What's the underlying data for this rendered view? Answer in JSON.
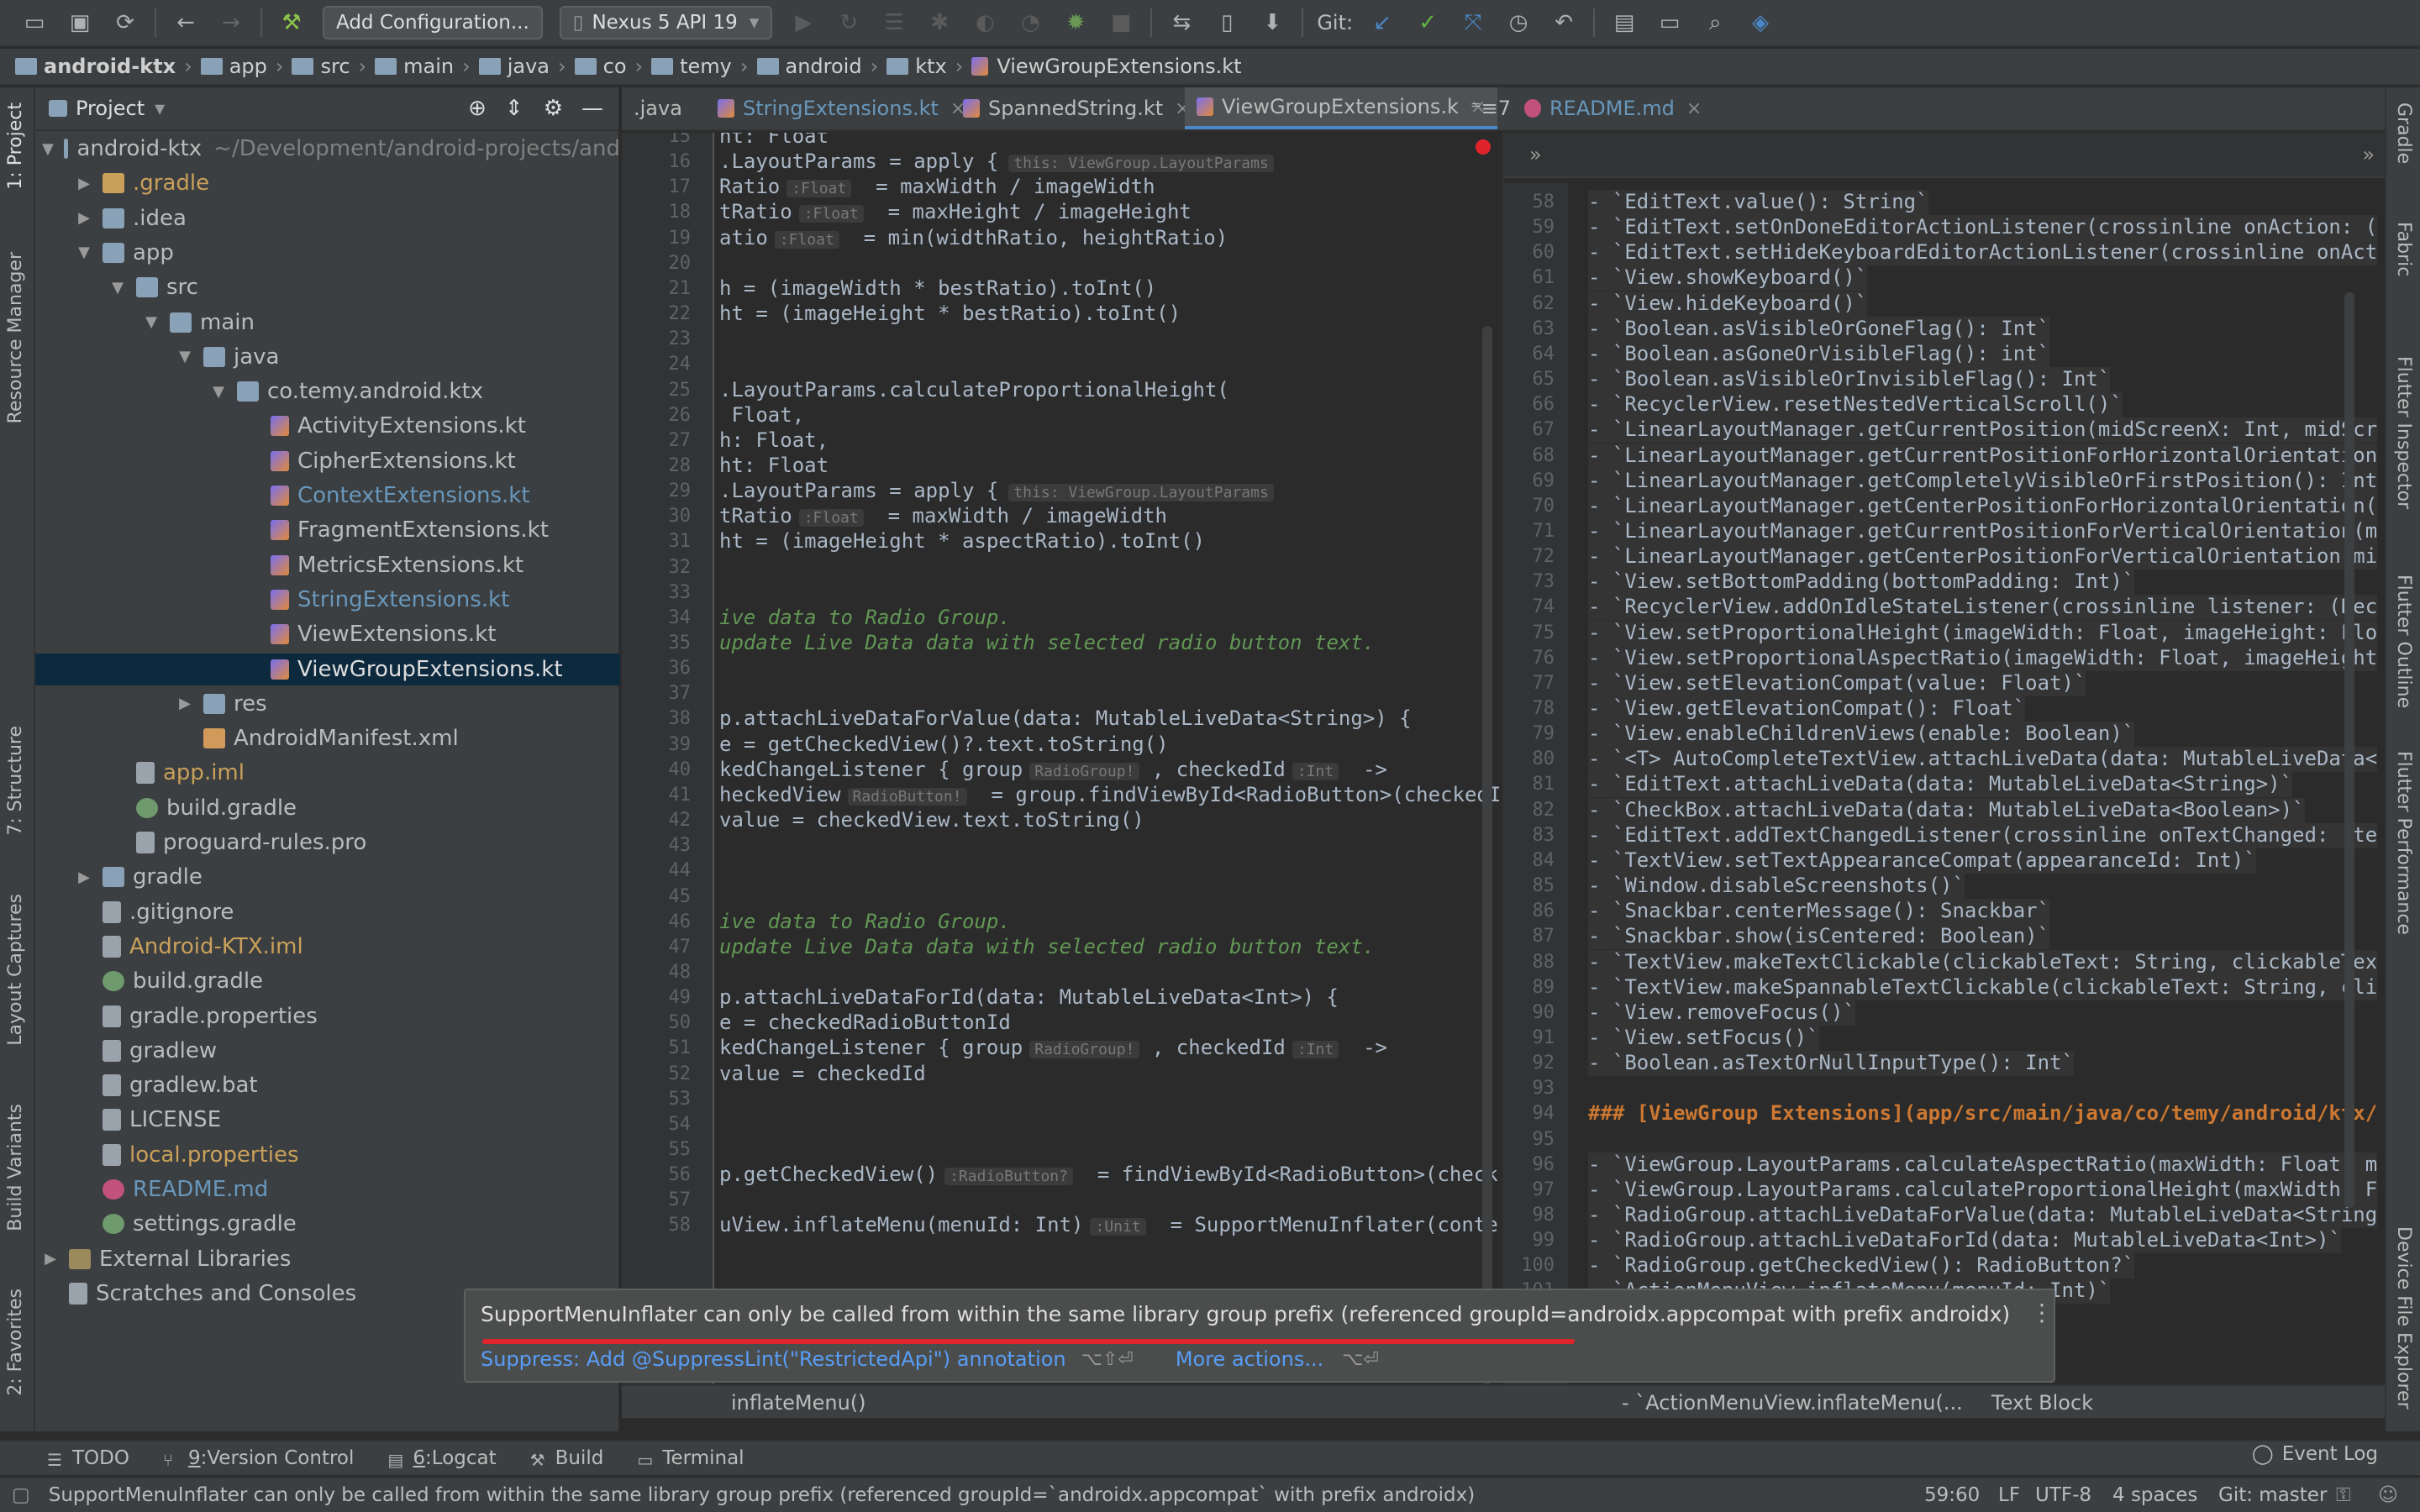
{
  "toolbar": {
    "add_config": "Add Configuration...",
    "device": "Nexus 5 API 19",
    "git_label": "Git:"
  },
  "breadcrumb": [
    "android-ktx",
    "app",
    "src",
    "main",
    "java",
    "co",
    "temy",
    "android",
    "ktx",
    "ViewGroupExtensions.kt"
  ],
  "left_stripe": {
    "project": "1: Project",
    "resource_manager": "Resource Manager",
    "structure": "7: Structure",
    "layout_captures": "Layout Captures",
    "build_variants": "Build Variants",
    "favorites": "2: Favorites"
  },
  "right_stripe": {
    "gradle": "Gradle",
    "fabric": "Fabric",
    "flutter_inspector": "Flutter Inspector",
    "flutter_outline": "Flutter Outline",
    "flutter_performance": "Flutter Performance",
    "device_file_explorer": "Device File Explorer"
  },
  "project": {
    "title": "Project",
    "tree": [
      {
        "label": "android-ktx",
        "extra": "~/Development/android-projects/and",
        "indent": 0,
        "arrow": "down",
        "icon": "folder",
        "color": "#bbbbbb"
      },
      {
        "label": ".gradle",
        "indent": 1,
        "arrow": "right",
        "icon": "folder-orange",
        "color": "#c9a05a"
      },
      {
        "label": ".idea",
        "indent": 1,
        "arrow": "right",
        "icon": "folder",
        "color": "#bbbbbb"
      },
      {
        "label": "app",
        "indent": 1,
        "arrow": "down",
        "icon": "folder",
        "color": "#bbbbbb"
      },
      {
        "label": "src",
        "indent": 2,
        "arrow": "down",
        "icon": "folder",
        "color": "#bbbbbb"
      },
      {
        "label": "main",
        "indent": 3,
        "arrow": "down",
        "icon": "folder",
        "color": "#bbbbbb"
      },
      {
        "label": "java",
        "indent": 4,
        "arrow": "down",
        "icon": "folder",
        "color": "#bbbbbb"
      },
      {
        "label": "co.temy.android.ktx",
        "indent": 5,
        "arrow": "down",
        "icon": "folder",
        "color": "#bbbbbb"
      },
      {
        "label": "ActivityExtensions.kt",
        "indent": 6,
        "arrow": "",
        "icon": "kt",
        "color": "#bbbbbb"
      },
      {
        "label": "CipherExtensions.kt",
        "indent": 6,
        "arrow": "",
        "icon": "kt",
        "color": "#bbbbbb"
      },
      {
        "label": "ContextExtensions.kt",
        "indent": 6,
        "arrow": "",
        "icon": "kt",
        "color": "#6897bb"
      },
      {
        "label": "FragmentExtensions.kt",
        "indent": 6,
        "arrow": "",
        "icon": "kt",
        "color": "#bbbbbb"
      },
      {
        "label": "MetricsExtensions.kt",
        "indent": 6,
        "arrow": "",
        "icon": "kt",
        "color": "#bbbbbb"
      },
      {
        "label": "StringExtensions.kt",
        "indent": 6,
        "arrow": "",
        "icon": "kt",
        "color": "#6897bb"
      },
      {
        "label": "ViewExtensions.kt",
        "indent": 6,
        "arrow": "",
        "icon": "kt",
        "color": "#bbbbbb"
      },
      {
        "label": "ViewGroupExtensions.kt",
        "indent": 6,
        "arrow": "",
        "icon": "kt",
        "color": "#dddddd",
        "selected": true
      },
      {
        "label": "res",
        "indent": 4,
        "arrow": "right",
        "icon": "folder",
        "color": "#bbbbbb"
      },
      {
        "label": "AndroidManifest.xml",
        "indent": 4,
        "arrow": "",
        "icon": "xml",
        "color": "#bbbbbb"
      },
      {
        "label": "app.iml",
        "indent": 2,
        "arrow": "",
        "icon": "file",
        "color": "#c9a05a"
      },
      {
        "label": "build.gradle",
        "indent": 2,
        "arrow": "",
        "icon": "gradle",
        "color": "#bbbbbb"
      },
      {
        "label": "proguard-rules.pro",
        "indent": 2,
        "arrow": "",
        "icon": "file",
        "color": "#bbbbbb"
      },
      {
        "label": "gradle",
        "indent": 1,
        "arrow": "right",
        "icon": "folder",
        "color": "#bbbbbb"
      },
      {
        "label": ".gitignore",
        "indent": 1,
        "arrow": "",
        "icon": "file",
        "color": "#bbbbbb"
      },
      {
        "label": "Android-KTX.iml",
        "indent": 1,
        "arrow": "",
        "icon": "file",
        "color": "#c9a05a"
      },
      {
        "label": "build.gradle",
        "indent": 1,
        "arrow": "",
        "icon": "gradle",
        "color": "#bbbbbb"
      },
      {
        "label": "gradle.properties",
        "indent": 1,
        "arrow": "",
        "icon": "file",
        "color": "#bbbbbb"
      },
      {
        "label": "gradlew",
        "indent": 1,
        "arrow": "",
        "icon": "file",
        "color": "#bbbbbb"
      },
      {
        "label": "gradlew.bat",
        "indent": 1,
        "arrow": "",
        "icon": "file",
        "color": "#bbbbbb"
      },
      {
        "label": "LICENSE",
        "indent": 1,
        "arrow": "",
        "icon": "file",
        "color": "#bbbbbb"
      },
      {
        "label": "local.properties",
        "indent": 1,
        "arrow": "",
        "icon": "file",
        "color": "#c9a05a"
      },
      {
        "label": "README.md",
        "indent": 1,
        "arrow": "",
        "icon": "md",
        "color": "#6897bb"
      },
      {
        "label": "settings.gradle",
        "indent": 1,
        "arrow": "",
        "icon": "gradle",
        "color": "#bbbbbb"
      },
      {
        "label": "External Libraries",
        "indent": 0,
        "arrow": "right",
        "icon": "lib",
        "color": "#bbbbbb"
      },
      {
        "label": "Scratches and Consoles",
        "indent": 0,
        "arrow": "",
        "icon": "file",
        "color": "#bbbbbb"
      }
    ]
  },
  "tabs": [
    {
      "label": ".java",
      "active": false
    },
    {
      "label": "StringExtensions.kt",
      "active": false
    },
    {
      "label": "SpannedString.kt",
      "active": false
    },
    {
      "label": "ViewGroupExtensions.k",
      "active": true
    },
    {
      "label": "7",
      "active": false
    },
    {
      "label": "README.md",
      "active": false
    }
  ],
  "editor_left": {
    "lines": [
      {
        "n": "15",
        "t": "ht: Float"
      },
      {
        "n": "16",
        "t": ".LayoutParams = apply {",
        "hint": "this: ViewGroup.LayoutParams"
      },
      {
        "n": "17",
        "t": "Ratio",
        "hint2": ":Float",
        "t2": "  = maxWidth / imageWidth"
      },
      {
        "n": "18",
        "t": "tRatio",
        "hint2": ":Float",
        "t2": "  = maxHeight / imageHeight"
      },
      {
        "n": "19",
        "t": "atio",
        "hint2": ":Float",
        "t2": "  = min(widthRatio, heightRatio)"
      },
      {
        "n": "20",
        "t": ""
      },
      {
        "n": "21",
        "t": "h = (imageWidth * bestRatio).toInt()"
      },
      {
        "n": "22",
        "t": "ht = (imageHeight * bestRatio).toInt()"
      },
      {
        "n": "23",
        "t": ""
      },
      {
        "n": "24",
        "t": ""
      },
      {
        "n": "25",
        "t": ".LayoutParams.calculateProportionalHeight("
      },
      {
        "n": "26",
        "t": " Float,"
      },
      {
        "n": "27",
        "t": "h: Float,"
      },
      {
        "n": "28",
        "t": "ht: Float"
      },
      {
        "n": "29",
        "t": ".LayoutParams = apply {",
        "hint": "this: ViewGroup.LayoutParams"
      },
      {
        "n": "30",
        "t": "tRatio",
        "hint2": ":Float",
        "t2": "  = maxWidth / imageWidth"
      },
      {
        "n": "31",
        "t": "ht = (imageHeight * aspectRatio).toInt()"
      },
      {
        "n": "32",
        "t": ""
      },
      {
        "n": "33",
        "t": ""
      },
      {
        "n": "34",
        "t": "ive data to Radio Group.",
        "comment": true
      },
      {
        "n": "35",
        "t": "update Live Data data with selected radio button text.",
        "comment": true
      },
      {
        "n": "36",
        "t": ""
      },
      {
        "n": "37",
        "t": ""
      },
      {
        "n": "38",
        "t": "p.attachLiveDataForValue(data: MutableLiveData<String>) {"
      },
      {
        "n": "39",
        "t": "e = getCheckedView()?.text.toString()"
      },
      {
        "n": "40",
        "t": "kedChangeListener { group",
        "hint2": "RadioGroup!",
        "t2": " , checkedId",
        "hint3": ":Int",
        "t3": "  ->"
      },
      {
        "n": "41",
        "t": "heckedView",
        "hint2": "RadioButton!",
        "t2": "  = group.findViewById<RadioButton>(checkedId"
      },
      {
        "n": "42",
        "t": "value = checkedView.text.toString()"
      },
      {
        "n": "43",
        "t": ""
      },
      {
        "n": "44",
        "t": ""
      },
      {
        "n": "45",
        "t": ""
      },
      {
        "n": "46",
        "t": "ive data to Radio Group.",
        "comment": true
      },
      {
        "n": "47",
        "t": "update Live Data data with selected radio button text.",
        "comment": true
      },
      {
        "n": "48",
        "t": ""
      },
      {
        "n": "49",
        "t": "p.attachLiveDataForId(data: MutableLiveData<Int>) {"
      },
      {
        "n": "50",
        "t": "e = checkedRadioButtonId"
      },
      {
        "n": "51",
        "t": "kedChangeListener { group",
        "hint2": "RadioGroup!",
        "t2": " , checkedId",
        "hint3": ":Int",
        "t3": "  ->"
      },
      {
        "n": "52",
        "t": "value = checkedId"
      },
      {
        "n": "53",
        "t": ""
      },
      {
        "n": "54",
        "t": ""
      },
      {
        "n": "55",
        "t": ""
      },
      {
        "n": "56",
        "t": "p.getCheckedView()",
        "hint2": ":RadioButton?",
        "t2": "  = findViewById<RadioButton>(checked"
      },
      {
        "n": "57",
        "t": ""
      },
      {
        "n": "58",
        "t": "uView.inflateMenu(menuId: Int)",
        "hint2": ":Unit",
        "t2": "  = SupportMenuInflater(context)"
      }
    ]
  },
  "editor_right": {
    "lines": [
      {
        "n": "58",
        "t": "- `EditText.value(): String`"
      },
      {
        "n": "59",
        "t": "- `EditText.setOnDoneEditorActionListener(crossinline onAction: ("
      },
      {
        "n": "60",
        "t": "- `EditText.setHideKeyboardEditorActionListener(crossinline onAct"
      },
      {
        "n": "61",
        "t": "- `View.showKeyboard()`"
      },
      {
        "n": "62",
        "t": "- `View.hideKeyboard()`"
      },
      {
        "n": "63",
        "t": "- `Boolean.asVisibleOrGoneFlag(): Int`"
      },
      {
        "n": "64",
        "t": "- `Boolean.asGoneOrVisibleFlag(): int`"
      },
      {
        "n": "65",
        "t": "- `Boolean.asVisibleOrInvisibleFlag(): Int`"
      },
      {
        "n": "66",
        "t": "- `RecyclerView.resetNestedVerticalScroll()`"
      },
      {
        "n": "67",
        "t": "- `LinearLayoutManager.getCurrentPosition(midScreenX: Int, midScr"
      },
      {
        "n": "68",
        "t": "- `LinearLayoutManager.getCurrentPositionForHorizontalOrientation"
      },
      {
        "n": "69",
        "t": "- `LinearLayoutManager.getCompletelyVisibleOrFirstPosition(): Int"
      },
      {
        "n": "70",
        "t": "- `LinearLayoutManager.getCenterPositionForHorizontalOrientation("
      },
      {
        "n": "71",
        "t": "- `LinearLayoutManager.getCurrentPositionForVerticalOrientation(m"
      },
      {
        "n": "72",
        "t": "- `LinearLayoutManager.getCenterPositionForVerticalOrientation(mi"
      },
      {
        "n": "73",
        "t": "- `View.setBottomPadding(bottomPadding: Int)`"
      },
      {
        "n": "74",
        "t": "- `RecyclerView.addOnIdleStateListener(crossinline listener: (Rec"
      },
      {
        "n": "75",
        "t": "- `View.setProportionalHeight(imageWidth: Float, imageHeight: Flo"
      },
      {
        "n": "76",
        "t": "- `View.setProportionalAspectRatio(imageWidth: Float, imageHeight"
      },
      {
        "n": "77",
        "t": "- `View.setElevationCompat(value: Float)`"
      },
      {
        "n": "78",
        "t": "- `View.getElevationCompat(): Float`"
      },
      {
        "n": "79",
        "t": "- `View.enableChildrenViews(enable: Boolean)`"
      },
      {
        "n": "80",
        "t": "- `<T> AutoCompleteTextView.attachLiveData(data: MutableLiveData<"
      },
      {
        "n": "81",
        "t": "- `EditText.attachLiveData(data: MutableLiveData<String>)`"
      },
      {
        "n": "82",
        "t": "- `CheckBox.attachLiveData(data: MutableLiveData<Boolean>)`"
      },
      {
        "n": "83",
        "t": "- `EditText.addTextChangedListener(crossinline onTextChanged: (te"
      },
      {
        "n": "84",
        "t": "- `TextView.setTextAppearanceCompat(appearanceId: Int)`"
      },
      {
        "n": "85",
        "t": "- `Window.disableScreenshots()`"
      },
      {
        "n": "86",
        "t": "- `Snackbar.centerMessage(): Snackbar`"
      },
      {
        "n": "87",
        "t": "- `Snackbar.show(isCentered: Boolean)`"
      },
      {
        "n": "88",
        "t": "- `TextView.makeTextClickable(clickableText: String, clickableTex"
      },
      {
        "n": "89",
        "t": "- `TextView.makeSpannableTextClickable(clickableText: String, cli"
      },
      {
        "n": "90",
        "t": "- `View.removeFocus()`"
      },
      {
        "n": "91",
        "t": "- `View.setFocus()`"
      },
      {
        "n": "92",
        "t": "- `Boolean.asTextOrNullInputType(): Int`"
      },
      {
        "n": "93",
        "t": ""
      },
      {
        "n": "94",
        "t": "### [ViewGroup Extensions](app/src/main/java/co/temy/android/ktx/",
        "head": true
      },
      {
        "n": "95",
        "t": ""
      },
      {
        "n": "96",
        "t": "- `ViewGroup.LayoutParams.calculateAspectRatio(maxWidth: Float, m"
      },
      {
        "n": "97",
        "t": "- `ViewGroup.LayoutParams.calculateProportionalHeight(maxWidth: F"
      },
      {
        "n": "98",
        "t": "- `RadioGroup.attachLiveDataForValue(data: MutableLiveData<String"
      },
      {
        "n": "99",
        "t": "- `RadioGroup.attachLiveDataForId(data: MutableLiveData<Int>)`"
      },
      {
        "n": "100",
        "t": "- `RadioGroup.getCheckedView(): RadioButton?`"
      },
      {
        "n": "101",
        "t": "- `ActionMenuView.inflateMenu(menuId: Int)`"
      }
    ]
  },
  "tooltip": {
    "message": "SupportMenuInflater can only be called from within the same library group prefix (referenced groupId=androidx.appcompat with prefix androidx)",
    "suppress": "Suppress: Add @SuppressLint(\"RestrictedApi\") annotation",
    "suppress_shortcut": "⌥⇧⏎",
    "more": "More actions...",
    "more_shortcut": "⌥⏎"
  },
  "editor_footer": {
    "left": "inflateMenu()",
    "right": "- `ActionMenuView.inflateMenu(...",
    "right2": "Text Block"
  },
  "bottom_tabs": [
    {
      "label": "TODO",
      "num": ""
    },
    {
      "label": "Version Control",
      "num": "9"
    },
    {
      "label": "Logcat",
      "num": "6"
    },
    {
      "label": "Build",
      "num": ""
    },
    {
      "label": "Terminal",
      "num": ""
    }
  ],
  "event_log": "Event Log",
  "status": {
    "message": "SupportMenuInflater can only be called from within the same library group prefix (referenced groupId=`androidx.appcompat` with prefix androidx)",
    "position": "59:60",
    "line_sep": "LF",
    "encoding": "UTF-8",
    "indent": "4 spaces",
    "git": "Git: master"
  }
}
